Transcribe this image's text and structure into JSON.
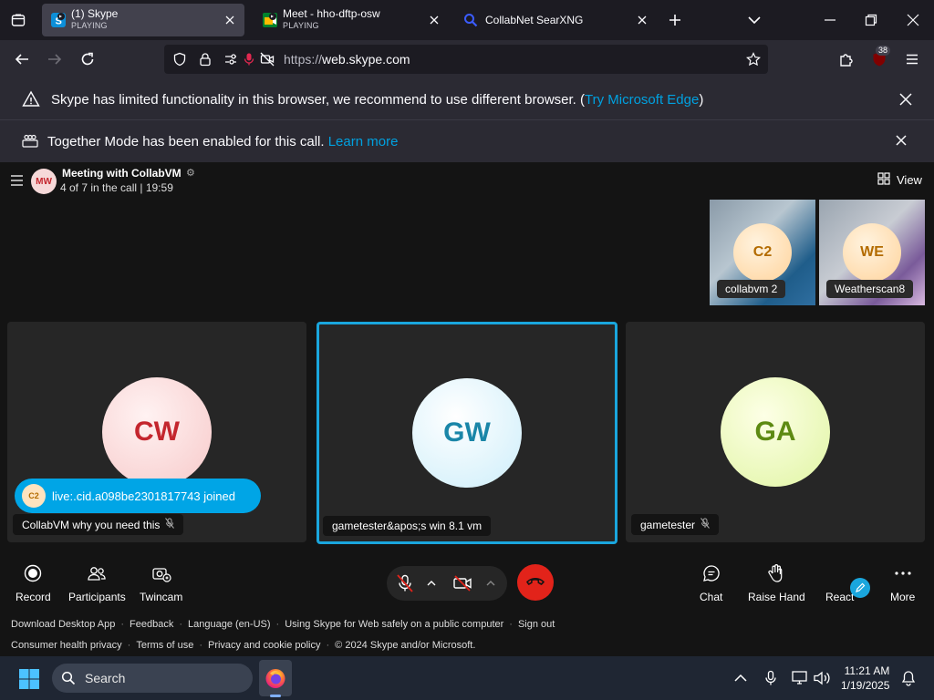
{
  "browser": {
    "tabs": [
      {
        "title": "(1) Skype",
        "sub": "PLAYING"
      },
      {
        "title": "Meet - hho-dftp-osw",
        "sub": "PLAYING"
      },
      {
        "title": "CollabNet SearXNG",
        "sub": ""
      }
    ],
    "url_prefix": "https://",
    "url_domain": "web.skype.com",
    "ext_badge": "38"
  },
  "notifications": {
    "edge_text": "Skype has limited functionality in this browser, we recommend to use different browser. (",
    "edge_link": "Try Microsoft Edge",
    "edge_tail": ")",
    "together_text": "Together Mode has been enabled for this call.",
    "together_link": "Learn more"
  },
  "meeting": {
    "avatar": "MW",
    "title": "Meeting with CollabVM",
    "subtitle": "4 of 7 in the call | 19:59",
    "view_label": "View"
  },
  "thumbs": [
    {
      "initials": "C2",
      "name": "collabvm 2"
    },
    {
      "initials": "WE",
      "name": "Weatherscan8"
    }
  ],
  "tiles": [
    {
      "initials": "CW",
      "name": "CollabVM why you need this",
      "color": "#c4262e"
    },
    {
      "initials": "GW",
      "name": "gametester&apos;s win 8.1 vm",
      "color": "#1a86a8"
    },
    {
      "initials": "GA",
      "name": "gametester",
      "color": "#5d8a12"
    }
  ],
  "toast": {
    "avatar": "C2",
    "text": "live:.cid.a098be2301817743 joined"
  },
  "controls": {
    "record": "Record",
    "participants": "Participants",
    "twincam": "Twincam",
    "chat": "Chat",
    "raise_hand": "Raise Hand",
    "react": "React",
    "more": "More"
  },
  "footer": {
    "row1": [
      "Download Desktop App",
      "Feedback",
      "Language (en-US)",
      "Using Skype for Web safely on a public computer",
      "Sign out"
    ],
    "row2": [
      "Consumer health privacy",
      "Terms of use",
      "Privacy and cookie policy",
      "© 2024 Skype and/or Microsoft."
    ]
  },
  "taskbar": {
    "search": "Search",
    "time": "11:21 AM",
    "date": "1/19/2025"
  }
}
